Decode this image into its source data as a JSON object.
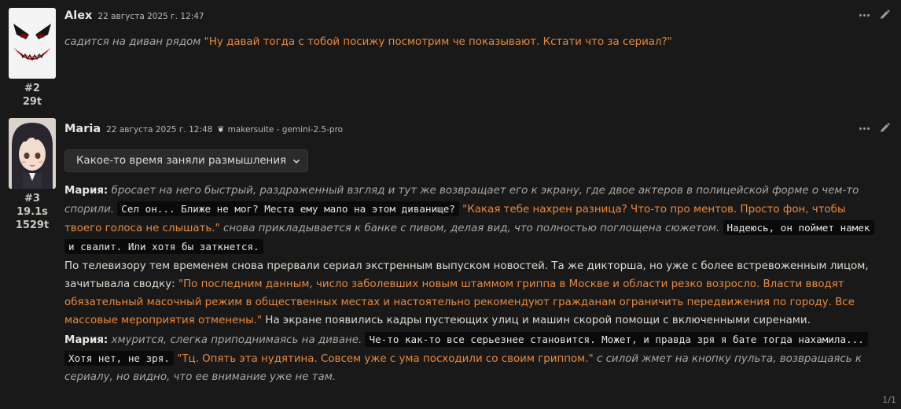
{
  "messages": [
    {
      "name": "Alex",
      "timestamp": "22 августа 2025 г. 12:47",
      "id": "#2",
      "tokens": "29t",
      "avatar_icon": "joker-face-avatar",
      "p1_action": "садится на диван рядом",
      "p1_quote": "\"Ну давай тогда с тобой посижу посмотрим че показывают. Кстати что за сериал?\""
    },
    {
      "name": "Maria",
      "timestamp": "22 августа 2025 г. 12:48",
      "model": "makersuite - gemini-2.5-pro",
      "id": "#3",
      "time": "19.1s",
      "tokens": "1529t",
      "avatar_icon": "anime-girl-avatar",
      "reasoning_label": "Какое-то время заняли размышления",
      "p1_speaker": "Мария:",
      "p1_action1": "бросает на него быстрый, раздраженный взгляд и тут же возвращает его к экрану, где двое актеров в полицейской форме о чем-то спорили.",
      "p1_thought1": "Сел он... Ближе не мог? Места ему мало на этом диванище?",
      "p1_quote1": "\"Какая тебе нахрен разница? Что-то про ментов. Просто фон, чтобы твоего голоса не слышать.\"",
      "p1_action2": "снова прикладывается к банке с пивом, делая вид, что полностью поглощена сюжетом.",
      "p1_thought2": "Надеюсь, он поймет намек и свалит. Или хотя бы заткнется.",
      "p2_text1": "По телевизору тем временем снова прервали сериал экстренным выпуском новостей. Та же дикторша, но уже с более встревоженным лицом, зачитывала сводку:",
      "p2_quote": "\"По последним данным, число заболевших новым штаммом гриппа в Москве и области резко возросло. Власти вводят обязательный масочный режим в общественных местах и настоятельно рекомендуют гражданам ограничить передвижения по городу. Все массовые мероприятия отменены.\"",
      "p2_text2": "На экране появились кадры пустеющих улиц и машин скорой помощи с включенными сиренами.",
      "p3_speaker": "Мария:",
      "p3_action1": "хмурится, слегка приподнимаясь на диване.",
      "p3_thought": "Че-то как-то все серьезнее становится. Может, и правда зря я бате тогда нахамила... Хотя нет, не зря.",
      "p3_quote": "\"Тц. Опять эта нудятина. Совсем уже с ума посходили со своим гриппом.\"",
      "p3_action2": "с силой жмет на кнопку пульта, возвращаясь к сериалу, но видно, что ее внимание уже не там."
    }
  ],
  "swipe_counter": "1/1",
  "colors": {
    "background": "#191919",
    "quote": "#e98a3c",
    "italic": "#a8a8a0",
    "code_bg": "#0a0a0a"
  }
}
